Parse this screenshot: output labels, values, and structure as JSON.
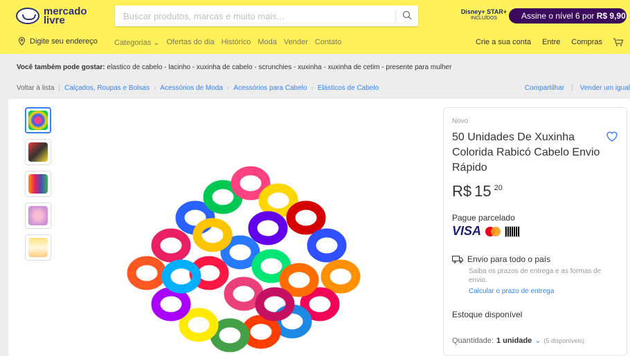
{
  "header": {
    "logo_line1": "mercado",
    "logo_line2": "livre",
    "search_placeholder": "Buscar produtos, marcas e muito mais...",
    "disney_brand": "Disney+ STAR+",
    "disney_sub": "INCLUÍDOS",
    "promo_text": "Assine o nível 6 por ",
    "promo_price": "R$ 9,90"
  },
  "nav": {
    "address": "Digite seu endereço",
    "categories": "Categorias",
    "items": [
      "Ofertas do dia",
      "Histórico",
      "Moda",
      "Vender",
      "Contato"
    ],
    "right": [
      "Crie a sua conta",
      "Entre",
      "Compras"
    ]
  },
  "recommendations": {
    "label": "Você também pode gostar:",
    "text": " elastico de cabelo - lacinho - xuxinha de cabelo - scrunchies - xuxinha - xuxinha de cetim - presente para mulher"
  },
  "breadcrumb": {
    "back": "Voltar à lista",
    "items": [
      "Calçados, Roupas e Bolsas",
      "Acessórios de Moda",
      "Acessórios para Cabelo",
      "Elásticos de Cabelo"
    ],
    "share": "Compartilhar",
    "sell": "Vender um igual"
  },
  "product": {
    "condition": "Novo",
    "title": "50 Unidades De Xuxinha Colorida Rabicó Cabelo Envio Rápido",
    "currency": "R$",
    "price_int": "15",
    "price_cents": "20",
    "installments": "Pague parcelado",
    "visa": "VISA",
    "boleto": "Boleto",
    "shipping_title": "Envio para todo o país",
    "shipping_desc": "Saiba os prazos de entrega e as formas de envio.",
    "shipping_link": "Calcular o prazo de entrega",
    "stock": "Estoque disponível",
    "qty_label": "Quantidade:",
    "qty_value": "1 unidade",
    "qty_available": "(5 disponíveis)"
  },
  "colors": {
    "header_bg": "#fff159",
    "link": "#3483fa",
    "promo_bg": "#3b0a5c"
  }
}
